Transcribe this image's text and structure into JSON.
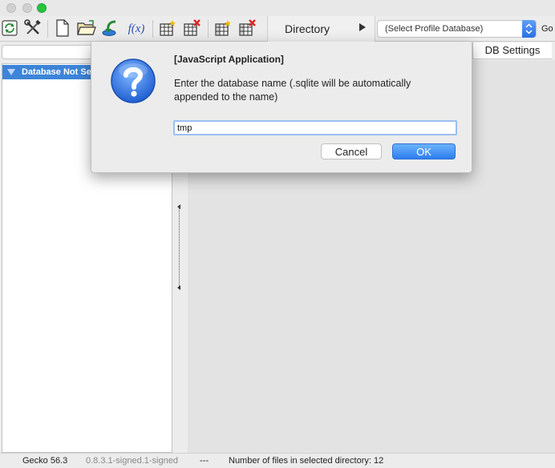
{
  "window": {
    "title": ""
  },
  "toolbar": {
    "buttons": [
      {
        "name": "refresh-button",
        "icon": "refresh-icon"
      },
      {
        "name": "tools-button",
        "icon": "wrench-screwdriver-icon"
      },
      {
        "name": "new-database-button",
        "icon": "new-document-icon"
      },
      {
        "name": "open-database-button",
        "icon": "open-folder-icon"
      },
      {
        "name": "attach-database-button",
        "icon": "attach-arrow-icon"
      },
      {
        "name": "functions-button",
        "icon": "function-icon",
        "label": "f(x)"
      },
      {
        "name": "create-table-button",
        "icon": "table-new-icon"
      },
      {
        "name": "drop-table-button",
        "icon": "table-delete-icon"
      },
      {
        "name": "create-index-button",
        "icon": "index-new-icon"
      },
      {
        "name": "drop-index-button",
        "icon": "index-delete-icon"
      }
    ],
    "directory_label": "Directory",
    "profile_select_value": "(Select Profile Database)",
    "go_label": "Go"
  },
  "secondbar": {
    "search_placeholder": "",
    "db_settings_label": "DB Settings"
  },
  "tree": {
    "root_label": "Database Not Se"
  },
  "statusbar": {
    "engine": "Gecko 56.3",
    "version": "0.8.3.1-signed.1-signed",
    "separator": "---",
    "file_count_text": "Number of files in selected directory: 12"
  },
  "dialog": {
    "title": "[JavaScript Application]",
    "message": "Enter the database name (.sqlite will be automatically appended to the name)",
    "input_value": "tmp",
    "cancel_label": "Cancel",
    "ok_label": "OK"
  },
  "colors": {
    "accent": "#3d84d9",
    "ok_button": "#2d7ef0",
    "background": "#ececec"
  }
}
